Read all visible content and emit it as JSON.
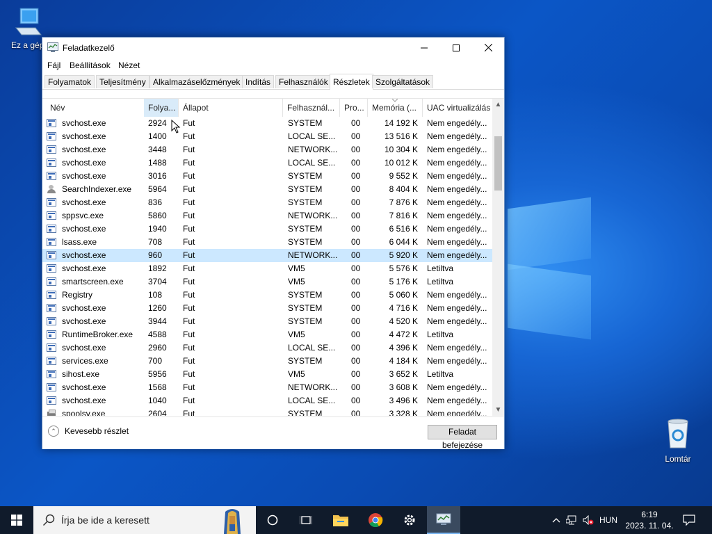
{
  "desktop": {
    "icons": [
      {
        "label": "Ez a gép"
      },
      {
        "label": "Lomtár"
      }
    ]
  },
  "window": {
    "title": "Feladatkezelő",
    "menu": [
      "Fájl",
      "Beállítások",
      "Nézet"
    ],
    "tabs": [
      "Folyamatok",
      "Teljesítmény",
      "Alkalmazáselőzmények",
      "Indítás",
      "Felhasználók",
      "Részletek",
      "Szolgáltatások"
    ],
    "active_tab": "Részletek",
    "columns": [
      "Név",
      "Folya...",
      "Állapot",
      "Felhasznál...",
      "Pro...",
      "Memória (...",
      "UAC virtualizálás"
    ],
    "rows": [
      {
        "name": "svchost.exe",
        "pid": "2924",
        "status": "Fut",
        "user": "SYSTEM",
        "cpu": "00",
        "mem": "14 192 K",
        "uac": "Nem engedély...",
        "icon": "service"
      },
      {
        "name": "svchost.exe",
        "pid": "1400",
        "status": "Fut",
        "user": "LOCAL SE...",
        "cpu": "00",
        "mem": "13 516 K",
        "uac": "Nem engedély...",
        "icon": "service"
      },
      {
        "name": "svchost.exe",
        "pid": "3448",
        "status": "Fut",
        "user": "NETWORK...",
        "cpu": "00",
        "mem": "10 304 K",
        "uac": "Nem engedély...",
        "icon": "service"
      },
      {
        "name": "svchost.exe",
        "pid": "1488",
        "status": "Fut",
        "user": "LOCAL SE...",
        "cpu": "00",
        "mem": "10 012 K",
        "uac": "Nem engedély...",
        "icon": "service"
      },
      {
        "name": "svchost.exe",
        "pid": "3016",
        "status": "Fut",
        "user": "SYSTEM",
        "cpu": "00",
        "mem": "9 552 K",
        "uac": "Nem engedély...",
        "icon": "service"
      },
      {
        "name": "SearchIndexer.exe",
        "pid": "5964",
        "status": "Fut",
        "user": "SYSTEM",
        "cpu": "00",
        "mem": "8 404 K",
        "uac": "Nem engedély...",
        "icon": "user"
      },
      {
        "name": "svchost.exe",
        "pid": "836",
        "status": "Fut",
        "user": "SYSTEM",
        "cpu": "00",
        "mem": "7 876 K",
        "uac": "Nem engedély...",
        "icon": "service"
      },
      {
        "name": "sppsvc.exe",
        "pid": "5860",
        "status": "Fut",
        "user": "NETWORK...",
        "cpu": "00",
        "mem": "7 816 K",
        "uac": "Nem engedély...",
        "icon": "service"
      },
      {
        "name": "svchost.exe",
        "pid": "1940",
        "status": "Fut",
        "user": "SYSTEM",
        "cpu": "00",
        "mem": "6 516 K",
        "uac": "Nem engedély...",
        "icon": "service"
      },
      {
        "name": "lsass.exe",
        "pid": "708",
        "status": "Fut",
        "user": "SYSTEM",
        "cpu": "00",
        "mem": "6 044 K",
        "uac": "Nem engedély...",
        "icon": "service"
      },
      {
        "name": "svchost.exe",
        "pid": "960",
        "status": "Fut",
        "user": "NETWORK...",
        "cpu": "00",
        "mem": "5 920 K",
        "uac": "Nem engedély...",
        "icon": "service",
        "selected": true
      },
      {
        "name": "svchost.exe",
        "pid": "1892",
        "status": "Fut",
        "user": "VM5",
        "cpu": "00",
        "mem": "5 576 K",
        "uac": "Letiltva",
        "icon": "service"
      },
      {
        "name": "smartscreen.exe",
        "pid": "3704",
        "status": "Fut",
        "user": "VM5",
        "cpu": "00",
        "mem": "5 176 K",
        "uac": "Letiltva",
        "icon": "service"
      },
      {
        "name": "Registry",
        "pid": "108",
        "status": "Fut",
        "user": "SYSTEM",
        "cpu": "00",
        "mem": "5 060 K",
        "uac": "Nem engedély...",
        "icon": "service"
      },
      {
        "name": "svchost.exe",
        "pid": "1260",
        "status": "Fut",
        "user": "SYSTEM",
        "cpu": "00",
        "mem": "4 716 K",
        "uac": "Nem engedély...",
        "icon": "service"
      },
      {
        "name": "svchost.exe",
        "pid": "3944",
        "status": "Fut",
        "user": "SYSTEM",
        "cpu": "00",
        "mem": "4 520 K",
        "uac": "Nem engedély...",
        "icon": "service"
      },
      {
        "name": "RuntimeBroker.exe",
        "pid": "4588",
        "status": "Fut",
        "user": "VM5",
        "cpu": "00",
        "mem": "4 472 K",
        "uac": "Letiltva",
        "icon": "service"
      },
      {
        "name": "svchost.exe",
        "pid": "2960",
        "status": "Fut",
        "user": "LOCAL SE...",
        "cpu": "00",
        "mem": "4 396 K",
        "uac": "Nem engedély...",
        "icon": "service"
      },
      {
        "name": "services.exe",
        "pid": "700",
        "status": "Fut",
        "user": "SYSTEM",
        "cpu": "00",
        "mem": "4 184 K",
        "uac": "Nem engedély...",
        "icon": "service"
      },
      {
        "name": "sihost.exe",
        "pid": "5956",
        "status": "Fut",
        "user": "VM5",
        "cpu": "00",
        "mem": "3 652 K",
        "uac": "Letiltva",
        "icon": "service"
      },
      {
        "name": "svchost.exe",
        "pid": "1568",
        "status": "Fut",
        "user": "NETWORK...",
        "cpu": "00",
        "mem": "3 608 K",
        "uac": "Nem engedély...",
        "icon": "service"
      },
      {
        "name": "svchost.exe",
        "pid": "1040",
        "status": "Fut",
        "user": "LOCAL SE...",
        "cpu": "00",
        "mem": "3 496 K",
        "uac": "Nem engedély...",
        "icon": "service"
      },
      {
        "name": "spoolsv.exe",
        "pid": "2604",
        "status": "Fut",
        "user": "SYSTEM",
        "cpu": "00",
        "mem": "3 328 K",
        "uac": "Nem engedély...",
        "icon": "printer"
      }
    ],
    "footer": {
      "fewer_details": "Kevesebb részlet",
      "end_task": "Feladat befejezése"
    }
  },
  "taskbar": {
    "search_placeholder": "Írja be ide a keresett",
    "language": "HUN",
    "time": "6:19",
    "date": "2023. 11. 04."
  }
}
